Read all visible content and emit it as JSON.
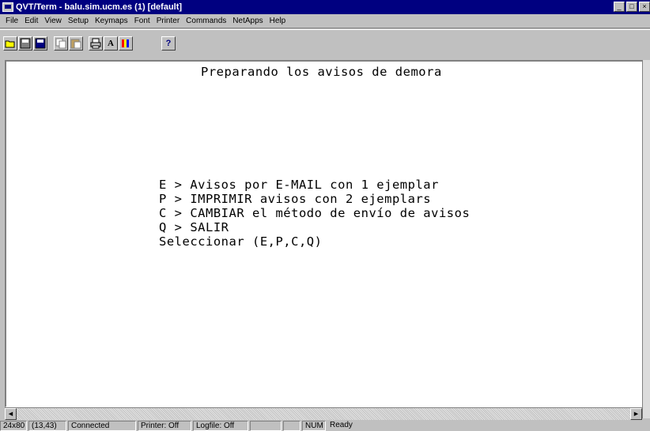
{
  "window": {
    "title": "QVT/Term - balu.sim.ucm.es (1) [default]",
    "controls": [
      "_",
      "□",
      "×"
    ]
  },
  "menu": [
    "File",
    "Edit",
    "View",
    "Setup",
    "Keymaps",
    "Font",
    "Printer",
    "Commands",
    "NetApps",
    "Help"
  ],
  "toolbar": {
    "buttons": [
      "open-icon",
      "save-icon",
      "disk-icon",
      "copy-icon",
      "paste-icon",
      "print-icon",
      "font-icon",
      "colors-icon",
      "help-icon"
    ],
    "font_label": "A",
    "help_label": "?"
  },
  "terminal": {
    "lines": [
      "Preparando los avisos de demora",
      "E > Avisos por E-MAIL con 1 ejemplar",
      "P > IMPRIMIR avisos con 2 ejemplars",
      "C > CAMBIAR el método de envío de avisos",
      "Q > SALIR",
      "Seleccionar (E,P,C,Q)"
    ]
  },
  "scrollbar": {
    "left_arrow": "◄",
    "right_arrow": "►"
  },
  "status": {
    "size": "24x80",
    "cursor": "(13,43)",
    "connection": "Connected",
    "printer": "Printer: Off",
    "logfile": "Logfile: Off",
    "blank1": "",
    "blank2": "",
    "num": "NUM",
    "ready": "Ready"
  }
}
